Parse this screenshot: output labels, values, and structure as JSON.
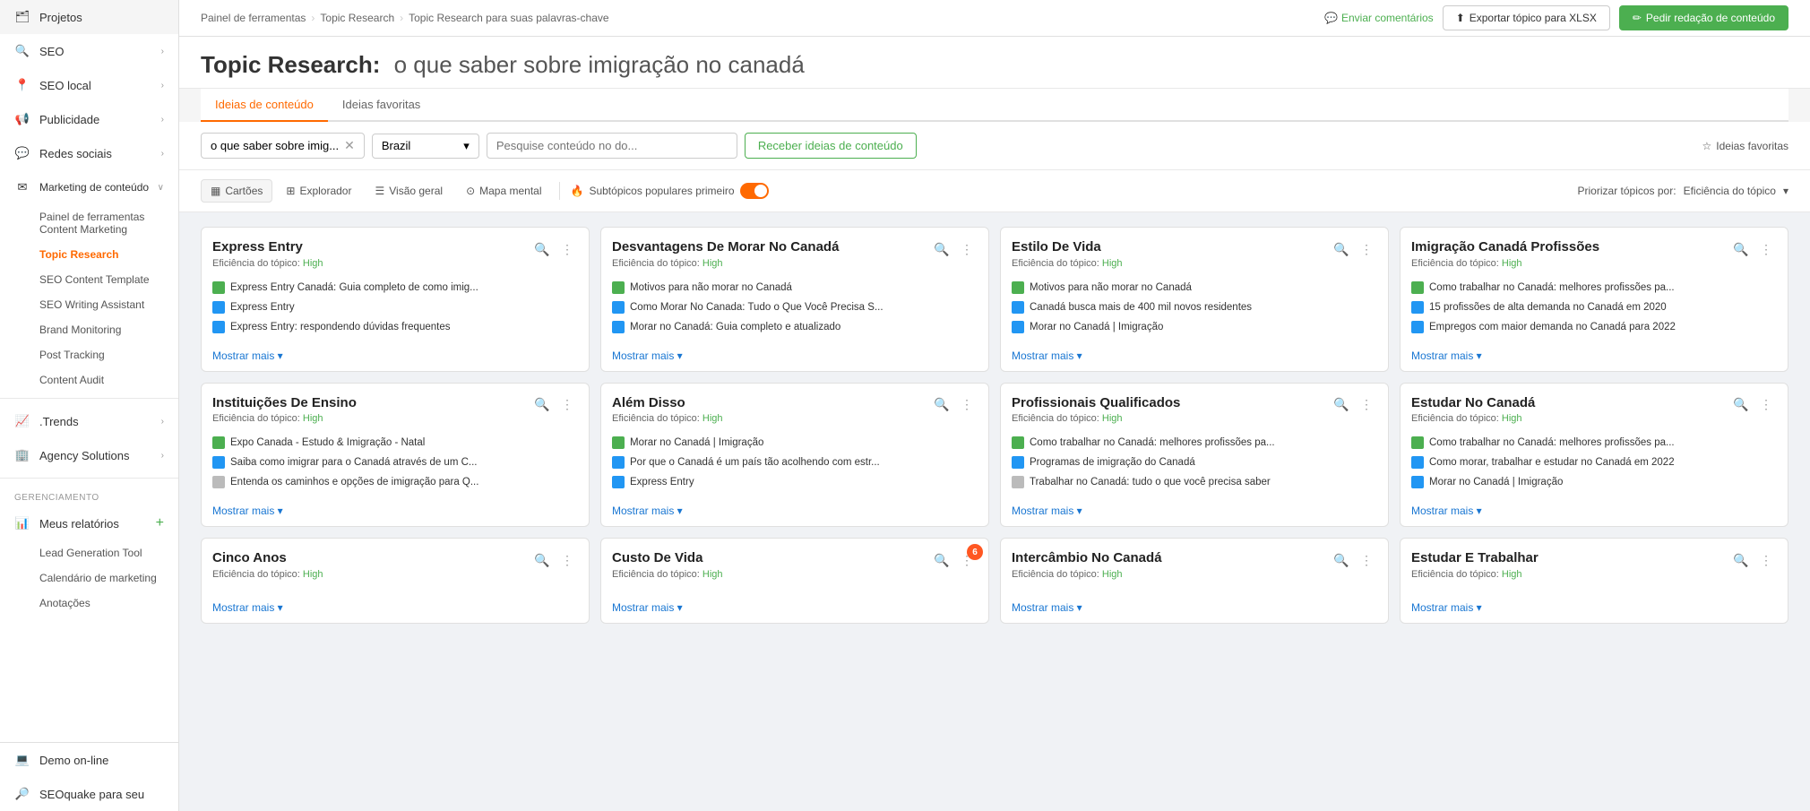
{
  "sidebar": {
    "items": [
      {
        "id": "projetos",
        "label": "Projetos",
        "icon": "icon-projetos",
        "hasChevron": false
      },
      {
        "id": "seo",
        "label": "SEO",
        "icon": "icon-seo",
        "hasChevron": true
      },
      {
        "id": "seo-local",
        "label": "SEO local",
        "icon": "icon-local",
        "hasChevron": true
      },
      {
        "id": "publicidade",
        "label": "Publicidade",
        "icon": "icon-pub",
        "hasChevron": true
      },
      {
        "id": "redes-sociais",
        "label": "Redes sociais",
        "icon": "icon-redes",
        "hasChevron": true
      },
      {
        "id": "marketing",
        "label": "Marketing de conteúdo",
        "icon": "icon-marketing",
        "hasChevron": true
      }
    ],
    "sub_items": [
      {
        "id": "painel",
        "label": "Painel de ferramentas Content Marketing"
      },
      {
        "id": "topic-research",
        "label": "Topic Research",
        "active": true
      },
      {
        "id": "seo-content",
        "label": "SEO Content Template"
      },
      {
        "id": "seo-writing",
        "label": "SEO Writing Assistant"
      },
      {
        "id": "brand-monitoring",
        "label": "Brand Monitoring"
      },
      {
        "id": "post-tracking",
        "label": "Post Tracking"
      },
      {
        "id": "content-audit",
        "label": "Content Audit"
      }
    ],
    "section_items": [
      {
        "id": "trends",
        "label": ".Trends",
        "icon": "icon-trends",
        "hasChevron": true
      },
      {
        "id": "agency",
        "label": "Agency Solutions",
        "icon": "icon-agency",
        "hasChevron": true
      }
    ],
    "management_label": "GERENCIAMENTO",
    "management_items": [
      {
        "id": "relatorios",
        "label": "Meus relatórios",
        "icon": "icon-relatorios",
        "hasPlus": true
      },
      {
        "id": "lead-gen",
        "label": "Lead Generation Tool"
      },
      {
        "id": "calendario",
        "label": "Calendário de marketing"
      },
      {
        "id": "anotacoes",
        "label": "Anotações"
      }
    ],
    "bottom_items": [
      {
        "id": "demo",
        "label": "Demo on-line",
        "icon": "icon-demo"
      },
      {
        "id": "seoquake",
        "label": "SEOquake para seu",
        "icon": "icon-seoq"
      }
    ]
  },
  "topbar": {
    "breadcrumb": [
      "Painel de ferramentas",
      "Topic Research",
      "Topic Research para suas palavras-chave"
    ],
    "feedback_label": "Enviar comentários",
    "export_label": "Exportar tópico para XLSX",
    "request_label": "Pedir redação de conteúdo"
  },
  "page_header": {
    "title_prefix": "Topic Research:",
    "title_topic": "o que saber sobre imigração no canadá"
  },
  "tabs": [
    {
      "id": "ideias-conteudo",
      "label": "Ideias de conteúdo",
      "active": true
    },
    {
      "id": "ideias-favoritas",
      "label": "Ideias favoritas",
      "active": false
    }
  ],
  "filters": {
    "search_value": "o que saber sobre imig...",
    "country_value": "Brazil",
    "search_placeholder": "Pesquise conteúdo no do...",
    "get_ideas_label": "Receber ideias de conteúdo",
    "favorites_label": "Ideias favoritas"
  },
  "view_controls": {
    "views": [
      {
        "id": "cartoes",
        "label": "Cartões",
        "active": true,
        "icon": "▦"
      },
      {
        "id": "explorador",
        "label": "Explorador",
        "active": false,
        "icon": "⊞"
      },
      {
        "id": "visao-geral",
        "label": "Visão geral",
        "active": false,
        "icon": "⊟"
      },
      {
        "id": "mapa-mental",
        "label": "Mapa mental",
        "active": false,
        "icon": "⊙"
      }
    ],
    "subtopics_label": "Subtópicos populares primeiro",
    "priority_label": "Priorizar tópicos por:",
    "priority_value": "Eficiência do tópico"
  },
  "cards": [
    {
      "id": "express-entry",
      "title": "Express Entry",
      "efficiency": "High",
      "items": [
        {
          "color": "green",
          "text": "Express Entry Canadá: Guia completo de como imig..."
        },
        {
          "color": "blue",
          "text": "Express Entry"
        },
        {
          "color": "blue",
          "text": "Express Entry: respondendo dúvidas frequentes"
        }
      ],
      "show_more": "Mostrar mais"
    },
    {
      "id": "desvantagens",
      "title": "Desvantagens De Morar No Canadá",
      "efficiency": "High",
      "items": [
        {
          "color": "green",
          "text": "Motivos para não morar no Canadá"
        },
        {
          "color": "blue",
          "text": "Como Morar No Canada: Tudo o Que Você Precisa S..."
        },
        {
          "color": "blue",
          "text": "Morar no Canadá: Guia completo e atualizado"
        }
      ],
      "show_more": "Mostrar mais"
    },
    {
      "id": "estilo-de-vida",
      "title": "Estilo De Vida",
      "efficiency": "High",
      "items": [
        {
          "color": "green",
          "text": "Motivos para não morar no Canadá"
        },
        {
          "color": "blue",
          "text": "Canadá busca mais de 400 mil novos residentes"
        },
        {
          "color": "blue",
          "text": "Morar no Canadá | Imigração"
        }
      ],
      "show_more": "Mostrar mais"
    },
    {
      "id": "imigracao-profissoes",
      "title": "Imigração Canadá Profissões",
      "efficiency": "High",
      "items": [
        {
          "color": "green",
          "text": "Como trabalhar no Canadá: melhores profissões pa..."
        },
        {
          "color": "blue",
          "text": "15 profissões de alta demanda no Canadá em 2020"
        },
        {
          "color": "blue",
          "text": "Empregos com maior demanda no Canadá para 2022"
        }
      ],
      "show_more": "Mostrar mais"
    },
    {
      "id": "instituicoes-ensino",
      "title": "Instituições De Ensino",
      "efficiency": "High",
      "items": [
        {
          "color": "green",
          "text": "Expo Canada - Estudo & Imigração - Natal"
        },
        {
          "color": "blue",
          "text": "Saiba como imigrar para o Canadá através de um C..."
        },
        {
          "color": "gray",
          "text": "Entenda os caminhos e opções de imigração para Q..."
        }
      ],
      "show_more": "Mostrar mais"
    },
    {
      "id": "alem-disso",
      "title": "Além Disso",
      "efficiency": "High",
      "items": [
        {
          "color": "green",
          "text": "Morar no Canadá | Imigração"
        },
        {
          "color": "blue",
          "text": "Por que o Canadá é um país tão acolhendo com estr..."
        },
        {
          "color": "blue",
          "text": "Express Entry"
        }
      ],
      "show_more": "Mostrar mais"
    },
    {
      "id": "profissionais-qualificados",
      "title": "Profissionais Qualificados",
      "efficiency": "High",
      "items": [
        {
          "color": "green",
          "text": "Como trabalhar no Canadá: melhores profissões pa..."
        },
        {
          "color": "blue",
          "text": "Programas de imigração do Canadá"
        },
        {
          "color": "gray",
          "text": "Trabalhar no Canadá: tudo o que você precisa saber"
        }
      ],
      "show_more": "Mostrar mais"
    },
    {
      "id": "estudar-canada",
      "title": "Estudar No Canadá",
      "efficiency": "High",
      "items": [
        {
          "color": "green",
          "text": "Como trabalhar no Canadá: melhores profissões pa..."
        },
        {
          "color": "blue",
          "text": "Como morar, trabalhar e estudar no Canadá em 2022"
        },
        {
          "color": "blue",
          "text": "Morar no Canadá | Imigração"
        }
      ],
      "show_more": "Mostrar mais"
    },
    {
      "id": "cinco-anos",
      "title": "Cinco Anos",
      "efficiency": "High",
      "items": [],
      "show_more": "Mostrar mais"
    },
    {
      "id": "custo-de-vida",
      "title": "Custo De Vida",
      "efficiency": "High",
      "items": [],
      "show_more": "Mostrar mais",
      "has_notification": true
    },
    {
      "id": "intercambio",
      "title": "Intercâmbio No Canadá",
      "efficiency": "High",
      "items": [],
      "show_more": "Mostrar mais"
    },
    {
      "id": "estudar-trabalhar",
      "title": "Estudar E Trabalhar",
      "efficiency": "High",
      "items": [],
      "show_more": "Mostrar mais"
    }
  ],
  "efficiency_label": "Eficiência do tópico:",
  "show_more_label": "Mostrar mais"
}
